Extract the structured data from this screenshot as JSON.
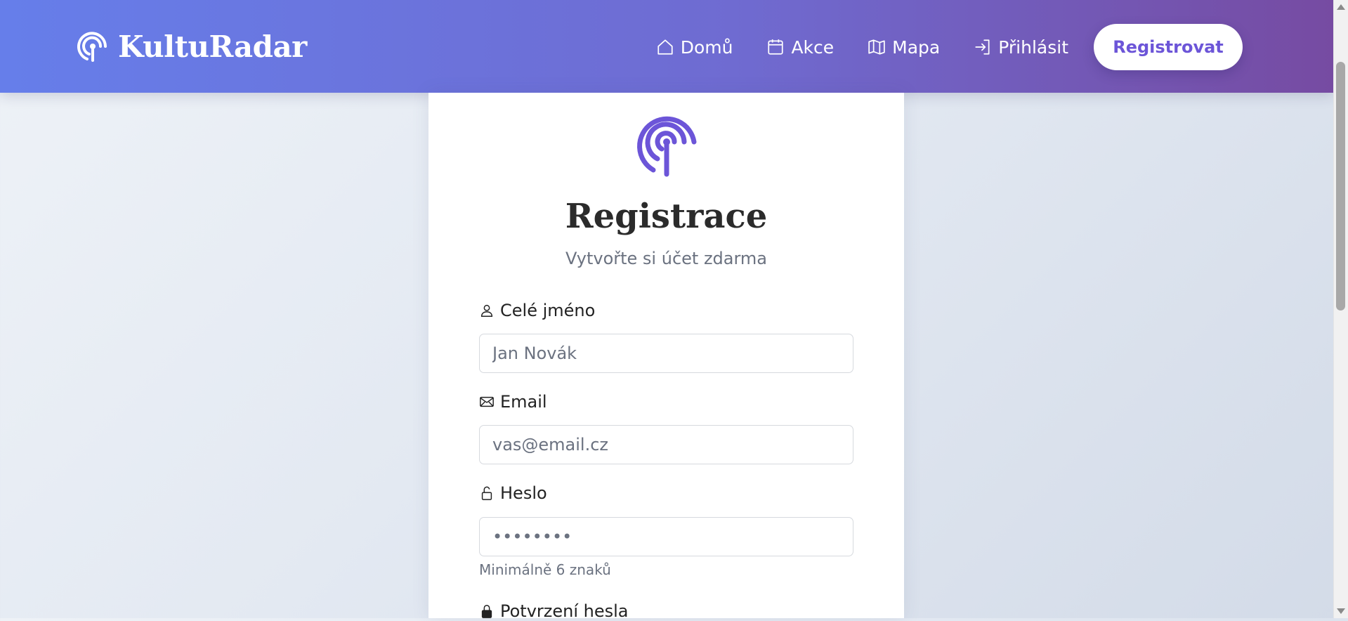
{
  "brand": {
    "name": "KultuRadar",
    "icon": "radar-icon"
  },
  "nav": {
    "links": [
      {
        "label": "Domů",
        "icon": "home-icon"
      },
      {
        "label": "Akce",
        "icon": "calendar-icon"
      },
      {
        "label": "Mapa",
        "icon": "map-icon"
      },
      {
        "label": "Přihlásit",
        "icon": "login-icon"
      }
    ],
    "register_label": "Registrovat"
  },
  "form": {
    "title": "Registrace",
    "subtitle": "Vytvořte si účet zdarma",
    "name_label": "Celé jméno",
    "name_placeholder": "Jan Novák",
    "email_label": "Email",
    "email_placeholder": "vas@email.cz",
    "password_label": "Heslo",
    "password_placeholder": "••••••••",
    "password_hint": "Minimálně 6 znaků",
    "confirm_label": "Potvrzení hesla"
  },
  "colors": {
    "nav_gradient_start": "#667eea",
    "nav_gradient_end": "#764ba2",
    "accent": "#6c55d8"
  }
}
